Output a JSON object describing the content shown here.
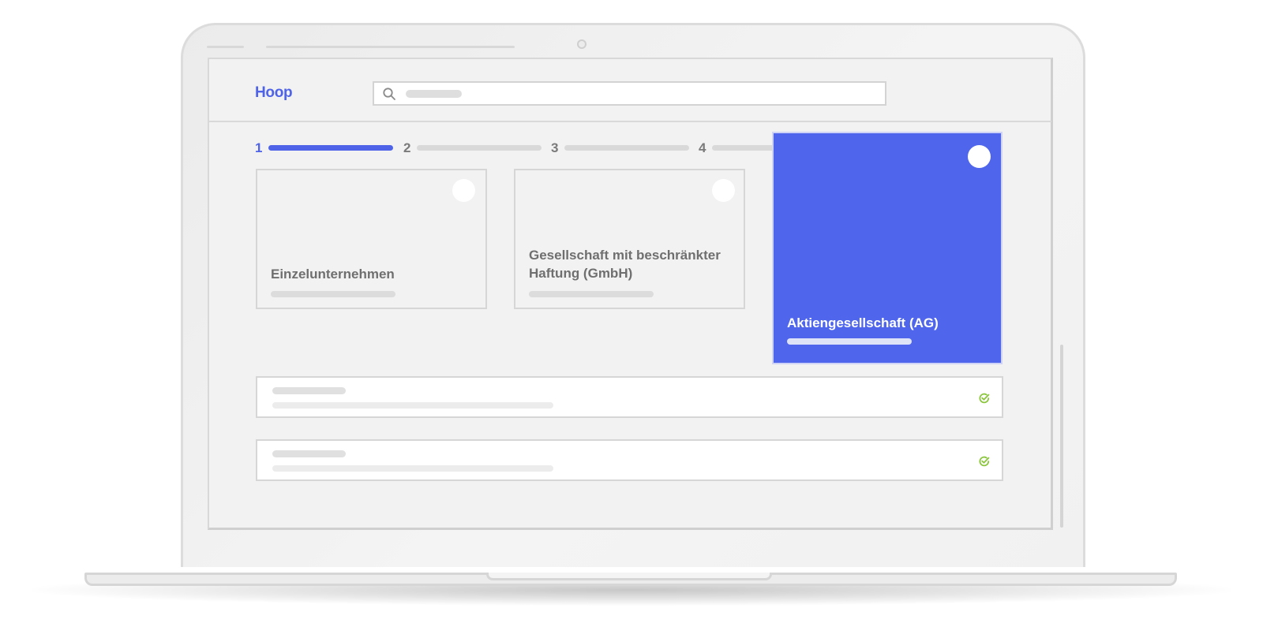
{
  "app": {
    "logo": "Hoop",
    "accent_color": "#4f63e8",
    "check_color": "#8cc63f"
  },
  "search": {
    "icon": "search-icon"
  },
  "stepper": {
    "steps": [
      {
        "label": "1",
        "active": true
      },
      {
        "label": "2",
        "active": false
      },
      {
        "label": "3",
        "active": false
      },
      {
        "label": "4",
        "active": false
      }
    ]
  },
  "legal_forms": {
    "options": [
      {
        "title": "Einzelunternehmen",
        "selected": false
      },
      {
        "title": "Gesellschaft mit beschränkter Haftung (GmbH)",
        "selected": false
      },
      {
        "title": "Aktiengesellschaft (AG)",
        "selected": true
      }
    ]
  },
  "rows": [
    {
      "status_icon": "check-circle-icon",
      "status": "complete"
    },
    {
      "status_icon": "check-circle-icon",
      "status": "complete"
    }
  ]
}
